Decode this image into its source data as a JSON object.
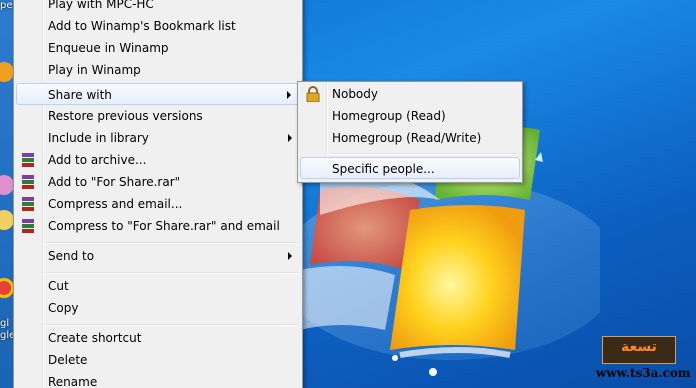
{
  "desktop": {
    "labels": [
      "pe",
      "gl",
      "gle"
    ]
  },
  "context_menu": {
    "items": [
      {
        "label": "Play with MPC-HC",
        "submenu": false
      },
      {
        "label": "Add to Winamp's Bookmark list",
        "submenu": false
      },
      {
        "label": "Enqueue in Winamp",
        "submenu": false
      },
      {
        "label": "Play in Winamp",
        "submenu": false
      },
      {
        "label": "Share with",
        "submenu": true,
        "highlighted": true
      },
      {
        "label": "Restore previous versions",
        "submenu": false
      },
      {
        "label": "Include in library",
        "submenu": true
      },
      {
        "label": "Add to archive...",
        "submenu": false,
        "icon": "winrar-icon"
      },
      {
        "label": "Add to \"For Share.rar\"",
        "submenu": false,
        "icon": "winrar-icon"
      },
      {
        "label": "Compress and email...",
        "submenu": false,
        "icon": "winrar-icon"
      },
      {
        "label": "Compress to \"For Share.rar\" and email",
        "submenu": false,
        "icon": "winrar-icon"
      },
      {
        "label": "Send to",
        "submenu": true
      },
      {
        "label": "Cut",
        "submenu": false
      },
      {
        "label": "Copy",
        "submenu": false
      },
      {
        "label": "Create shortcut",
        "submenu": false
      },
      {
        "label": "Delete",
        "submenu": false
      },
      {
        "label": "Rename",
        "submenu": false
      }
    ]
  },
  "share_submenu": {
    "items": [
      {
        "label": "Nobody",
        "icon": "lock-icon"
      },
      {
        "label": "Homegroup (Read)"
      },
      {
        "label": "Homegroup (Read/Write)"
      },
      {
        "label": "Specific people...",
        "highlighted": true
      }
    ]
  },
  "watermark": {
    "logo": "تسعة",
    "url": "www.ts3a.com"
  },
  "colors": {
    "menu_bg": "#f0f0f0",
    "highlight_border": "#b8d2f0",
    "wallpaper": "#1a8ae6"
  }
}
